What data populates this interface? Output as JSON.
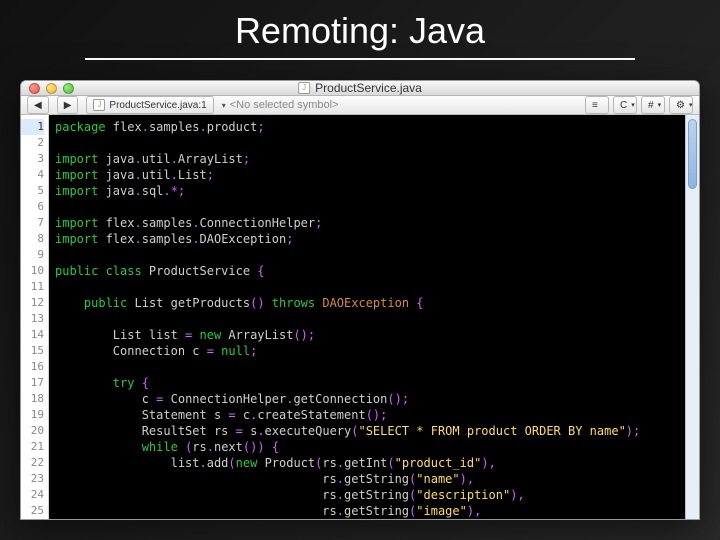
{
  "slide": {
    "title": "Remoting: Java"
  },
  "window": {
    "title": "ProductService.java",
    "toolbar": {
      "nav_back": "◀",
      "nav_fwd": "▶",
      "doc_label": "ProductService.java:1",
      "symbol_placeholder": "<No selected symbol>",
      "btn_c": "C",
      "btn_hash": "#",
      "btn_gear": "⚙"
    }
  },
  "code": {
    "lines": [
      {
        "n": 1,
        "tokens": [
          [
            "kw",
            "package"
          ],
          [
            "pkg",
            " flex"
          ],
          [
            "op",
            "."
          ],
          [
            "pkg",
            "samples"
          ],
          [
            "op",
            "."
          ],
          [
            "pkg",
            "product"
          ],
          [
            "op",
            ";"
          ]
        ]
      },
      {
        "n": 2,
        "tokens": []
      },
      {
        "n": 3,
        "tokens": [
          [
            "kw",
            "import"
          ],
          [
            "pkg",
            " java"
          ],
          [
            "op",
            "."
          ],
          [
            "pkg",
            "util"
          ],
          [
            "op",
            "."
          ],
          [
            "pkg",
            "ArrayList"
          ],
          [
            "op",
            ";"
          ]
        ]
      },
      {
        "n": 4,
        "tokens": [
          [
            "kw",
            "import"
          ],
          [
            "pkg",
            " java"
          ],
          [
            "op",
            "."
          ],
          [
            "pkg",
            "util"
          ],
          [
            "op",
            "."
          ],
          [
            "pkg",
            "List"
          ],
          [
            "op",
            ";"
          ]
        ]
      },
      {
        "n": 5,
        "tokens": [
          [
            "kw",
            "import"
          ],
          [
            "pkg",
            " java"
          ],
          [
            "op",
            "."
          ],
          [
            "pkg",
            "sql"
          ],
          [
            "op",
            "."
          ],
          [
            "op",
            "*"
          ],
          [
            "op",
            ";"
          ]
        ]
      },
      {
        "n": 6,
        "tokens": []
      },
      {
        "n": 7,
        "tokens": [
          [
            "kw",
            "import"
          ],
          [
            "pkg",
            " flex"
          ],
          [
            "op",
            "."
          ],
          [
            "pkg",
            "samples"
          ],
          [
            "op",
            "."
          ],
          [
            "pkg",
            "ConnectionHelper"
          ],
          [
            "op",
            ";"
          ]
        ]
      },
      {
        "n": 8,
        "tokens": [
          [
            "kw",
            "import"
          ],
          [
            "pkg",
            " flex"
          ],
          [
            "op",
            "."
          ],
          [
            "pkg",
            "samples"
          ],
          [
            "op",
            "."
          ],
          [
            "pkg",
            "DAOException"
          ],
          [
            "op",
            ";"
          ]
        ]
      },
      {
        "n": 9,
        "tokens": []
      },
      {
        "n": 10,
        "tokens": [
          [
            "kw",
            "public class"
          ],
          [
            "pkg",
            " ProductService "
          ],
          [
            "op",
            "{"
          ]
        ]
      },
      {
        "n": 11,
        "tokens": []
      },
      {
        "n": 12,
        "tokens": [
          [
            "pkg",
            "    "
          ],
          [
            "kw",
            "public"
          ],
          [
            "pkg",
            " List getProducts"
          ],
          [
            "op",
            "()"
          ],
          [
            "kw",
            " throws"
          ],
          [
            "ex",
            " DAOException "
          ],
          [
            "op",
            "{"
          ]
        ]
      },
      {
        "n": 13,
        "tokens": []
      },
      {
        "n": 14,
        "tokens": [
          [
            "pkg",
            "        List list "
          ],
          [
            "op",
            "="
          ],
          [
            "kw",
            " new"
          ],
          [
            "pkg",
            " ArrayList"
          ],
          [
            "op",
            "();"
          ]
        ]
      },
      {
        "n": 15,
        "tokens": [
          [
            "pkg",
            "        Connection c "
          ],
          [
            "op",
            "="
          ],
          [
            "kw",
            " null"
          ],
          [
            "op",
            ";"
          ]
        ]
      },
      {
        "n": 16,
        "tokens": []
      },
      {
        "n": 17,
        "tokens": [
          [
            "pkg",
            "        "
          ],
          [
            "kw",
            "try"
          ],
          [
            "pkg",
            " "
          ],
          [
            "op",
            "{"
          ]
        ]
      },
      {
        "n": 18,
        "tokens": [
          [
            "pkg",
            "            c "
          ],
          [
            "op",
            "="
          ],
          [
            "pkg",
            " ConnectionHelper"
          ],
          [
            "op",
            "."
          ],
          [
            "pkg",
            "getConnection"
          ],
          [
            "op",
            "();"
          ]
        ]
      },
      {
        "n": 19,
        "tokens": [
          [
            "pkg",
            "            Statement s "
          ],
          [
            "op",
            "="
          ],
          [
            "pkg",
            " c"
          ],
          [
            "op",
            "."
          ],
          [
            "pkg",
            "createStatement"
          ],
          [
            "op",
            "();"
          ]
        ]
      },
      {
        "n": 20,
        "tokens": [
          [
            "pkg",
            "            ResultSet rs "
          ],
          [
            "op",
            "="
          ],
          [
            "pkg",
            " s"
          ],
          [
            "op",
            "."
          ],
          [
            "pkg",
            "executeQuery"
          ],
          [
            "op",
            "("
          ],
          [
            "str",
            "\"SELECT * FROM product ORDER BY name\""
          ],
          [
            "op",
            ");"
          ]
        ]
      },
      {
        "n": 21,
        "tokens": [
          [
            "pkg",
            "            "
          ],
          [
            "kw",
            "while"
          ],
          [
            "pkg",
            " "
          ],
          [
            "op",
            "("
          ],
          [
            "pkg",
            "rs"
          ],
          [
            "op",
            "."
          ],
          [
            "pkg",
            "next"
          ],
          [
            "op",
            "())"
          ],
          [
            "pkg",
            " "
          ],
          [
            "op",
            "{"
          ]
        ]
      },
      {
        "n": 22,
        "tokens": [
          [
            "pkg",
            "                list"
          ],
          [
            "op",
            "."
          ],
          [
            "pkg",
            "add"
          ],
          [
            "op",
            "("
          ],
          [
            "kw",
            "new"
          ],
          [
            "pkg",
            " Product"
          ],
          [
            "op",
            "("
          ],
          [
            "pkg",
            "rs"
          ],
          [
            "op",
            "."
          ],
          [
            "pkg",
            "getInt"
          ],
          [
            "op",
            "("
          ],
          [
            "str",
            "\"product_id\""
          ],
          [
            "op",
            "),"
          ]
        ]
      },
      {
        "n": 23,
        "tokens": [
          [
            "pkg",
            "                                     rs"
          ],
          [
            "op",
            "."
          ],
          [
            "pkg",
            "getString"
          ],
          [
            "op",
            "("
          ],
          [
            "str",
            "\"name\""
          ],
          [
            "op",
            "),"
          ]
        ]
      },
      {
        "n": 24,
        "tokens": [
          [
            "pkg",
            "                                     rs"
          ],
          [
            "op",
            "."
          ],
          [
            "pkg",
            "getString"
          ],
          [
            "op",
            "("
          ],
          [
            "str",
            "\"description\""
          ],
          [
            "op",
            "),"
          ]
        ]
      },
      {
        "n": 25,
        "tokens": [
          [
            "pkg",
            "                                     rs"
          ],
          [
            "op",
            "."
          ],
          [
            "pkg",
            "getString"
          ],
          [
            "op",
            "("
          ],
          [
            "str",
            "\"image\""
          ],
          [
            "op",
            "),"
          ]
        ]
      }
    ]
  }
}
